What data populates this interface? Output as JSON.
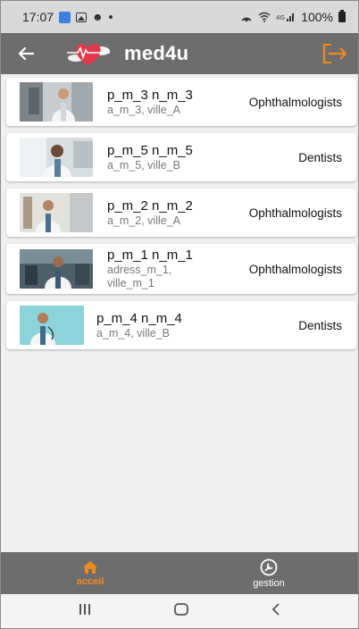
{
  "status_bar": {
    "time": "17:07",
    "battery": "100%"
  },
  "app_bar": {
    "title": "med4u",
    "accent": "#ef8a1f"
  },
  "doctors": [
    {
      "name": "p_m_3 n_m_3",
      "address": "a_m_3, ville_A",
      "specialty": "Ophthalmologists"
    },
    {
      "name": "p_m_5 n_m_5",
      "address": "a_m_5, ville_B",
      "specialty": "Dentists"
    },
    {
      "name": "p_m_2 n_m_2",
      "address": "a_m_2, ville_A",
      "specialty": "Ophthalmologists"
    },
    {
      "name": "p_m_1 n_m_1",
      "address": "adress_m_1,",
      "address2": "ville_m_1",
      "specialty": "Ophthalmologists"
    },
    {
      "name": "p_m_4 n_m_4",
      "address": "a_m_4, ville_B",
      "specialty": "Dentists"
    }
  ],
  "bottom_nav": {
    "items": [
      {
        "label": "acceil",
        "icon": "home-icon",
        "active": true
      },
      {
        "label": "gestion",
        "icon": "wrench-icon",
        "active": false
      }
    ]
  },
  "system_nav": {
    "icons": [
      "recents-icon",
      "home-circle-icon",
      "back-chevron-icon"
    ]
  }
}
